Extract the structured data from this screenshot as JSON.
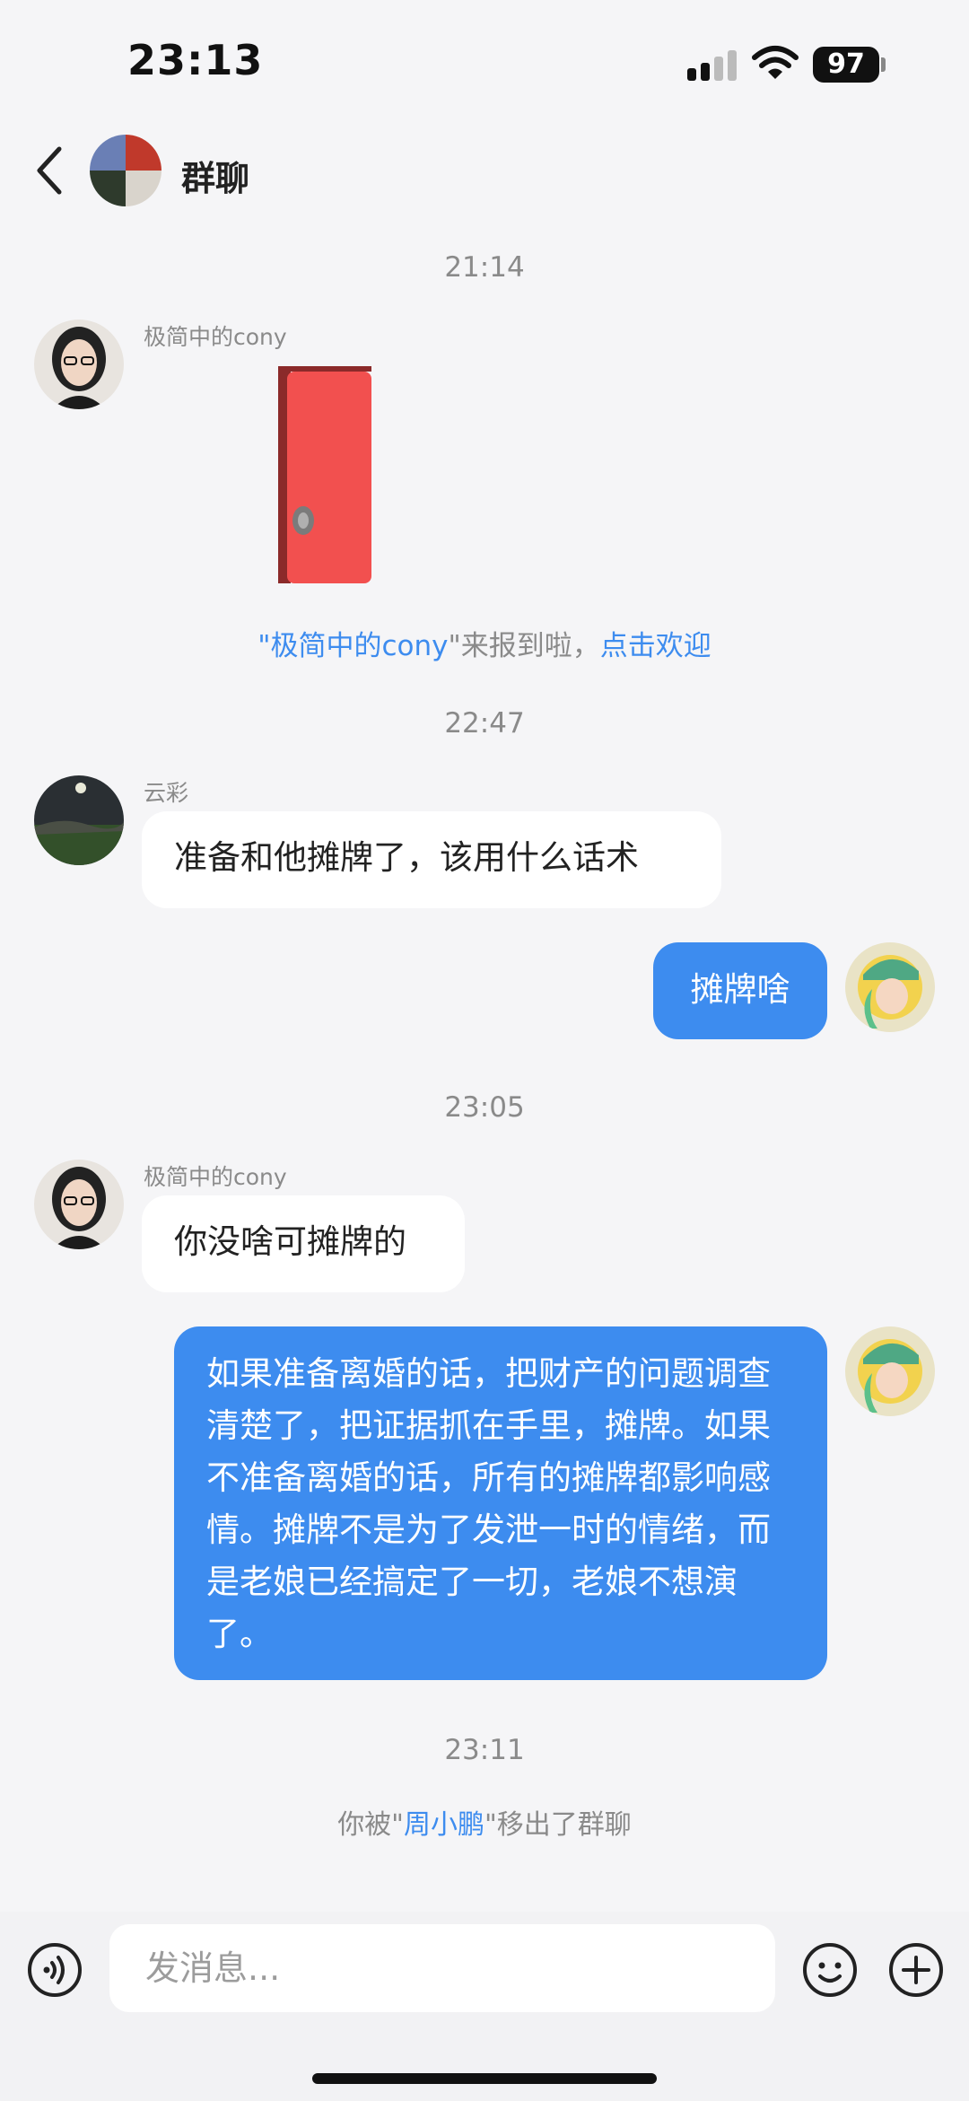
{
  "status_bar": {
    "time": "23:13",
    "battery": "97"
  },
  "header": {
    "title": "群聊"
  },
  "messages": {
    "ts1": "21:14",
    "sender1": "极简中的cony",
    "join_notice": {
      "quote_open": "\"",
      "name": "极简中的cony",
      "text": "\"来报到啦，",
      "action": "点击欢迎"
    },
    "ts2": "22:47",
    "sender2": "云彩",
    "msg2": "准备和他摊牌了，该用什么话术",
    "msg3": "摊牌啥",
    "ts3": "23:05",
    "sender3": "极简中的cony",
    "msg4": "你没啥可摊牌的",
    "msg5": "如果准备离婚的话，把财产的问题调查清楚了，把证据抓在手里，摊牌。如果不准备离婚的话，所有的摊牌都影响感情。摊牌不是为了发泄一时的情绪，而是老娘已经搞定了一切，老娘不想演了。",
    "ts4": "23:11",
    "removed_notice": {
      "prefix": "你被\"",
      "name": "周小鹏",
      "suffix": "\"移出了群聊"
    }
  },
  "input": {
    "placeholder": "发消息..."
  },
  "colors": {
    "accent": "#3d8cef",
    "bubble_out": "#3d8cef",
    "background": "#f5f5f7"
  }
}
